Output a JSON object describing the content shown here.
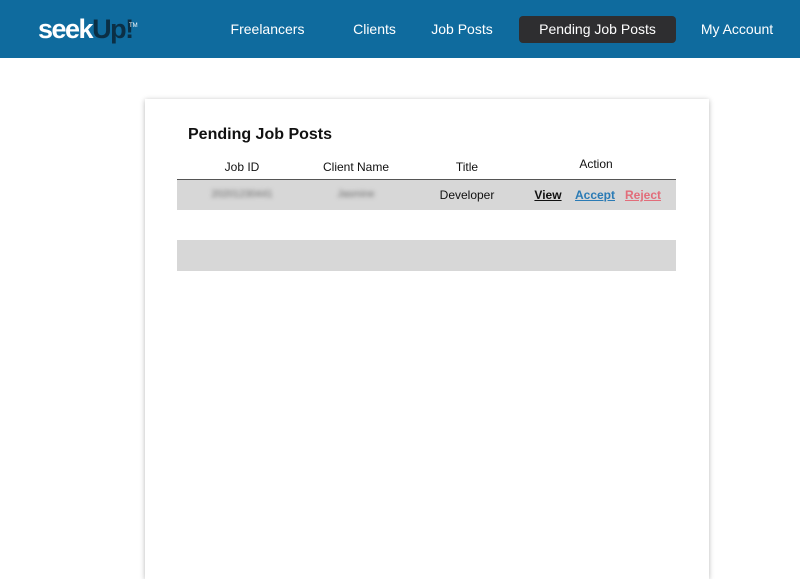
{
  "app": {
    "logo_seek": "seek",
    "logo_up": "Up!",
    "logo_tm": "TM"
  },
  "nav": {
    "items": [
      {
        "label": "Freelancers",
        "active": false
      },
      {
        "label": "Clients",
        "active": false
      },
      {
        "label": "Job Posts",
        "active": false
      },
      {
        "label": "Pending Job Posts",
        "active": true
      },
      {
        "label": "My Account",
        "active": false
      }
    ]
  },
  "main": {
    "title": "Pending Job Posts",
    "table": {
      "columns": [
        "Job ID",
        "Client Name",
        "Title",
        "Action"
      ],
      "rows": [
        {
          "job_id": "20201230441",
          "client_name": "Jasmine",
          "title": "Developer",
          "actions": {
            "view": "View",
            "accept": "Accept",
            "reject": "Reject"
          }
        }
      ]
    }
  },
  "colors": {
    "topbar": "#0f6b9e",
    "active_nav": "#2e2e30",
    "accept_link": "#2a7bb5",
    "reject_link": "#e26d7a",
    "row_stripe": "#d7d7d7"
  }
}
